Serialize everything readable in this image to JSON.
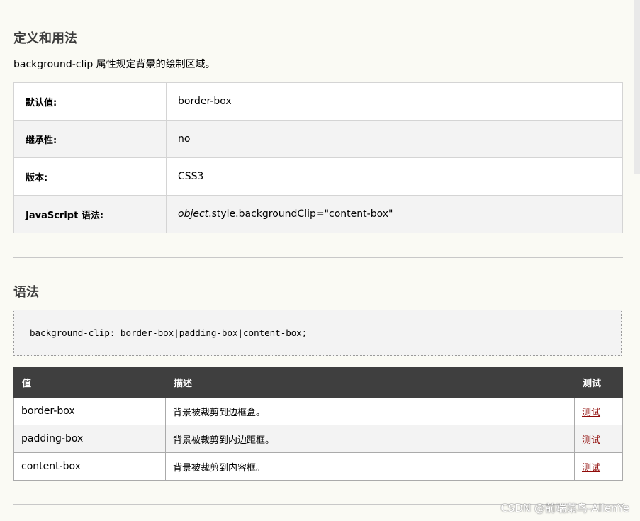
{
  "section1": {
    "title": "定义和用法",
    "intro": "background-clip 属性规定背景的绘制区域。",
    "properties": [
      {
        "key": "默认值:",
        "value": "border-box"
      },
      {
        "key": "继承性:",
        "value": "no"
      },
      {
        "key": "版本:",
        "value": "CSS3"
      },
      {
        "key": "JavaScript 语法:",
        "value_italic": "object",
        "value_rest": ".style.backgroundClip=\"content-box\""
      }
    ]
  },
  "section2": {
    "title": "语法",
    "code": "background-clip: border-box|padding-box|content-box;",
    "table": {
      "headers": [
        "值",
        "描述",
        "测试"
      ],
      "rows": [
        {
          "value": "border-box",
          "description": "背景被裁剪到边框盒。",
          "test": "测试"
        },
        {
          "value": "padding-box",
          "description": "背景被裁剪到内边距框。",
          "test": "测试"
        },
        {
          "value": "content-box",
          "description": "背景被裁剪到内容框。",
          "test": "测试"
        }
      ]
    }
  },
  "watermark": "CSDN @前端菜鸟-AllenYe"
}
